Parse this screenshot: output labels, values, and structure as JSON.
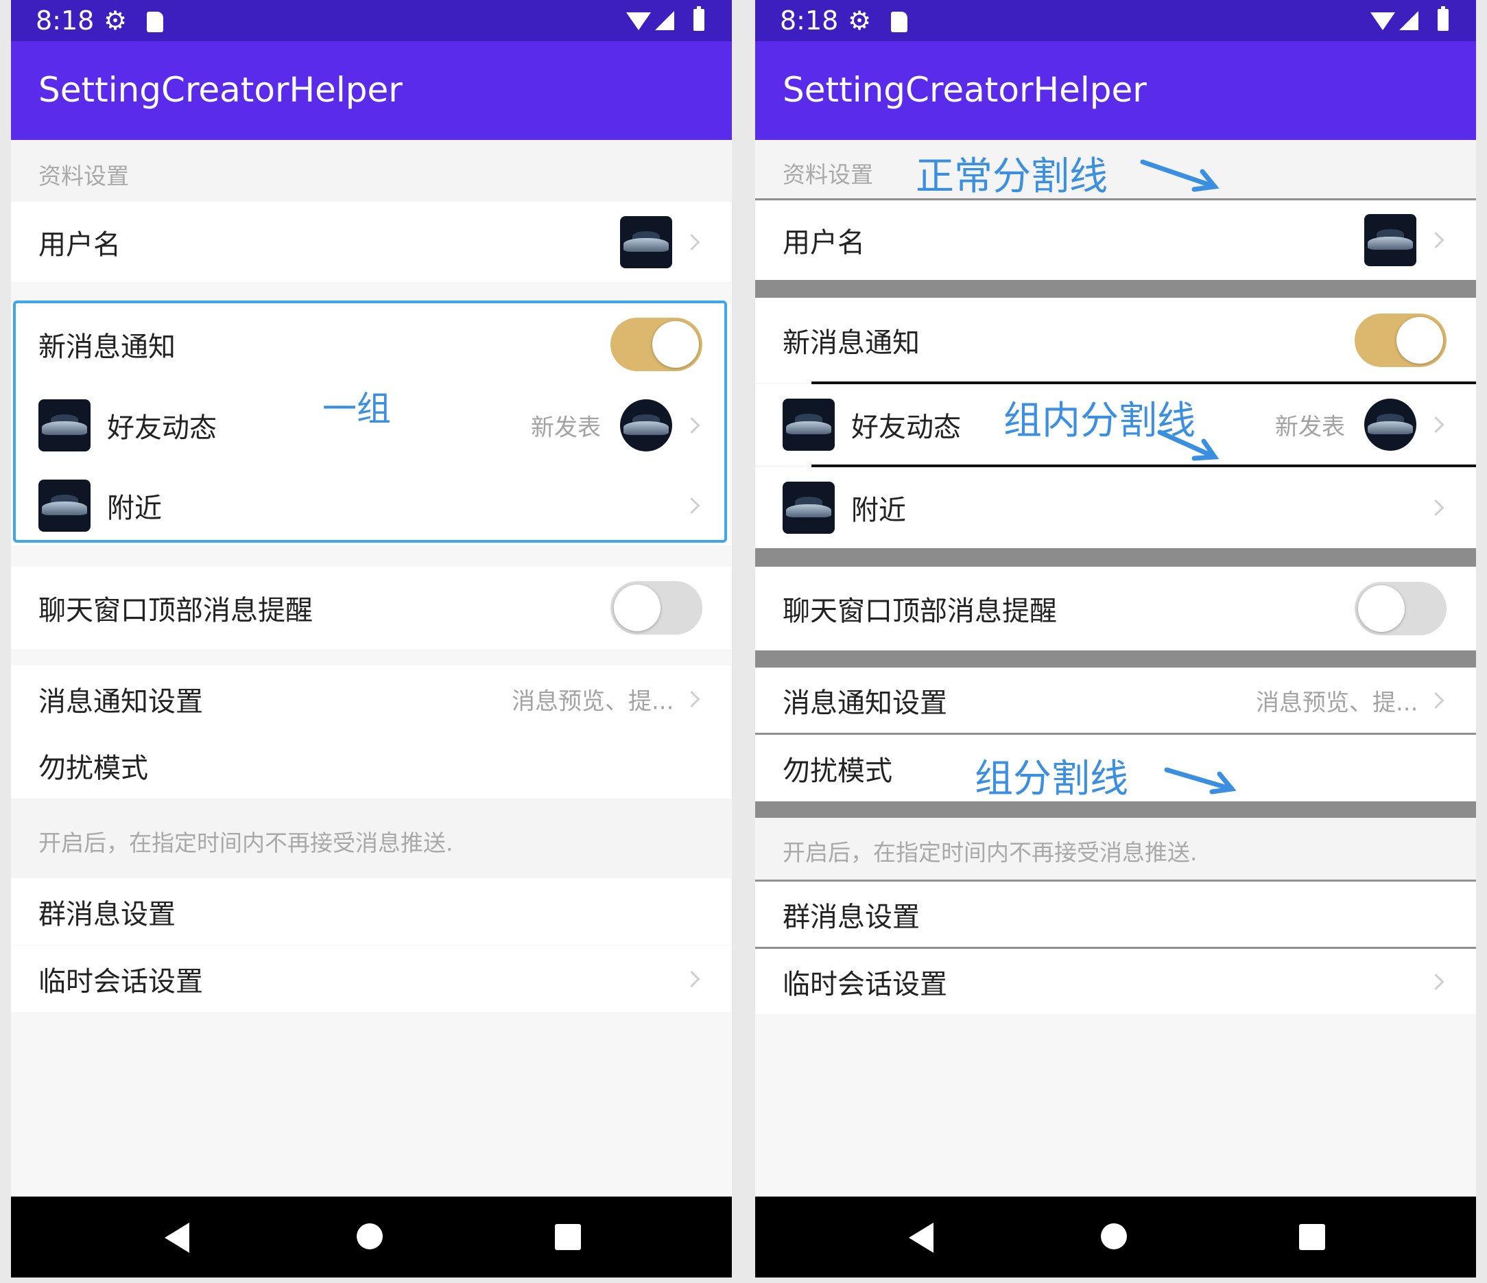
{
  "status_bar": {
    "time": "8:18",
    "icons": [
      "gear-icon",
      "sdcard-icon",
      "wifi-icon",
      "signal-icon",
      "battery-icon"
    ]
  },
  "app": {
    "title": "SettingCreatorHelper",
    "theme": {
      "status_bar": "#3d1fc0",
      "app_bar": "#5b2bec",
      "toggle_on": "#dcb86e",
      "toggle_off": "#dcdcdc",
      "annotation": "#3a8fe0"
    }
  },
  "settings": {
    "section_profile": "资料设置",
    "username": "用户名",
    "new_message_notify": "新消息通知",
    "new_message_notify_on": true,
    "friend_moments": "好友动态",
    "friend_moments_value": "新发表",
    "nearby": "附近",
    "chat_top_reminder": "聊天窗口顶部消息提醒",
    "chat_top_reminder_on": false,
    "message_notify_settings": "消息通知设置",
    "message_notify_settings_value": "消息预览、提...",
    "do_not_disturb": "勿扰模式",
    "dnd_hint": "开启后，在指定时间内不再接受消息推送.",
    "group_message_settings": "群消息设置",
    "temp_chat_settings": "临时会话设置"
  },
  "annotations": {
    "one_group": "一组",
    "normal_divider": "正常分割线",
    "inner_group_divider": "组内分割线",
    "group_divider": "组分割线"
  },
  "nav_bar": {
    "icons": [
      "back-icon",
      "home-icon",
      "recents-icon"
    ]
  }
}
